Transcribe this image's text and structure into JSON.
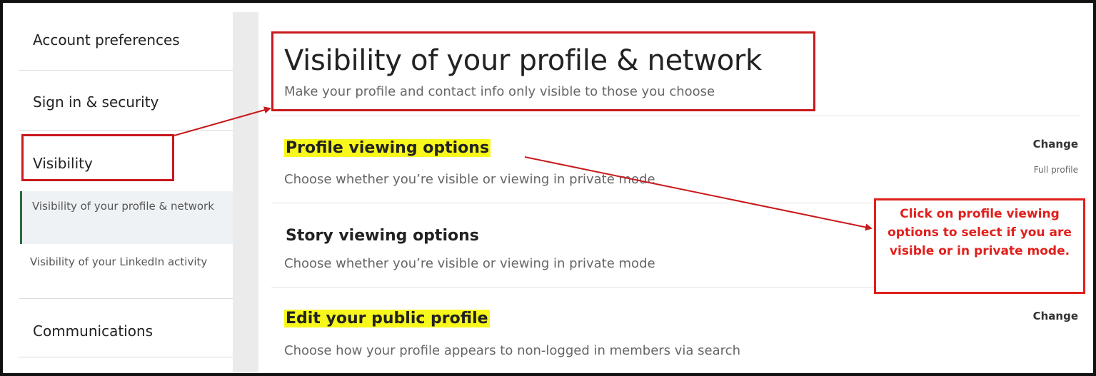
{
  "sidebar": {
    "items": [
      {
        "label": "Account preferences"
      },
      {
        "label": "Sign in & security"
      },
      {
        "label": "Visibility"
      },
      {
        "label": "Communications"
      }
    ],
    "sub_items": [
      {
        "label": "Visibility of your profile & network",
        "active": true
      },
      {
        "label": "Visibility of your LinkedIn activity",
        "active": false
      }
    ]
  },
  "main": {
    "title": "Visibility of your profile & network",
    "subtitle": "Make your profile and contact info only visible to those you choose",
    "options": [
      {
        "title": "Profile viewing options",
        "description": "Choose whether you’re visible or viewing in private mode",
        "action": "Change",
        "value": "Full profile"
      },
      {
        "title": "Story viewing options",
        "description": "Choose whether you’re visible or viewing in private mode"
      },
      {
        "title": "Edit your public profile",
        "description": "Choose how your profile appears to non-logged in members via search",
        "action": "Change"
      }
    ]
  },
  "annotation": {
    "callout_text": "Click on profile viewing options to select if you are visible or in private mode."
  },
  "colors": {
    "annotation_red": "#c8191c",
    "highlight_yellow": "#f8f71c",
    "active_marker_green": "#2e6a3f"
  }
}
